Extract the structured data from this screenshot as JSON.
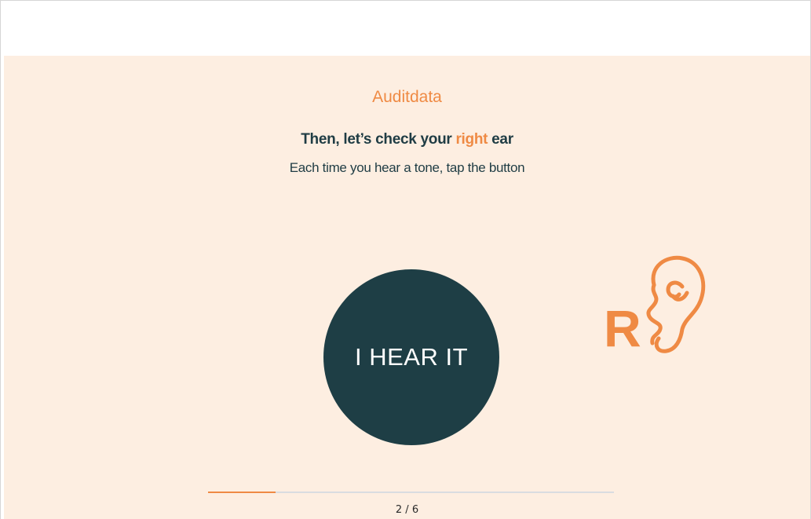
{
  "brand": {
    "name": "Auditdata"
  },
  "instruction": {
    "title_before": "Then, let’s check your",
    "title_accent": "right",
    "title_after": "ear",
    "subtitle": "Each time you hear a tone, tap the button"
  },
  "action": {
    "hear_button_label": "I HEAR IT"
  },
  "ear_indicator": {
    "letter": "R",
    "icon": "right-ear-icon"
  },
  "progress": {
    "text": "2 / 6",
    "fraction": 0.1667
  },
  "colors": {
    "accent": "#ef8a44",
    "dark": "#1e3e45",
    "background": "#fdeee1"
  }
}
